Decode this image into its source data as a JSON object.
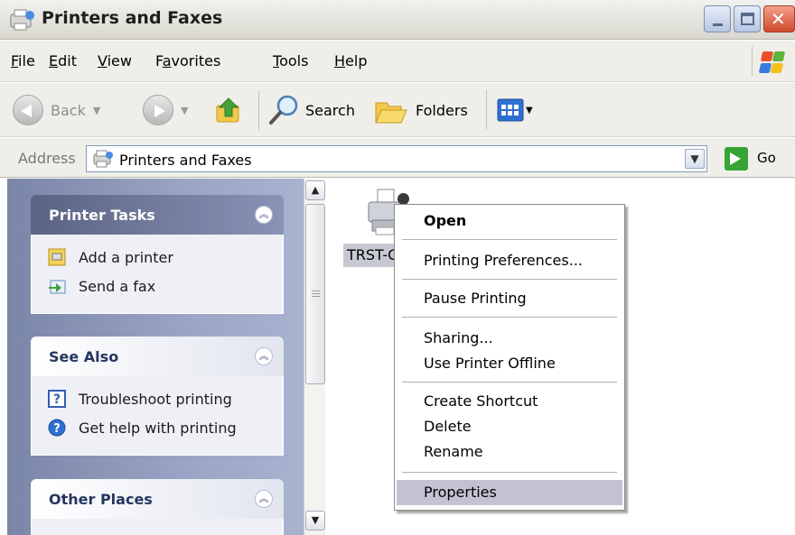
{
  "window": {
    "title": "Printers and Faxes"
  },
  "menubar": {
    "items": [
      {
        "label": "File",
        "key": "F",
        "rest": "ile"
      },
      {
        "label": "Edit",
        "key": "E",
        "rest": "dit"
      },
      {
        "label": "View",
        "key": "V",
        "rest": "iew"
      },
      {
        "label": "Favorites",
        "key": "a",
        "pre": "F",
        "rest": "vorites"
      },
      {
        "label": "Tools",
        "key": "T",
        "rest": "ools"
      },
      {
        "label": "Help",
        "key": "H",
        "rest": "elp"
      }
    ]
  },
  "toolbar": {
    "back_label": "Back",
    "search_label": "Search",
    "folders_label": "Folders"
  },
  "address": {
    "label": "Address",
    "value": "Printers and Faxes",
    "go_label": "Go"
  },
  "taskpane": {
    "printer_tasks": {
      "title": "Printer Tasks",
      "items": [
        "Add a printer",
        "Send a fax"
      ]
    },
    "see_also": {
      "title": "See Also",
      "items": [
        "Troubleshoot printing",
        "Get help with printing"
      ]
    },
    "other_places": {
      "title": "Other Places"
    }
  },
  "printer": {
    "label": "TRST-C",
    "status": "default-printer"
  },
  "context_menu": {
    "items": [
      "Open",
      "Printing Preferences...",
      "Pause Printing",
      "Sharing...",
      "Use Printer Offline",
      "Create Shortcut",
      "Delete",
      "Rename",
      "Properties"
    ],
    "selected": "Properties",
    "default": "Open"
  },
  "colors": {
    "taskpane_bg": "#9aa4c4",
    "selection": "#c4c2d2",
    "go_green": "#36a535"
  }
}
